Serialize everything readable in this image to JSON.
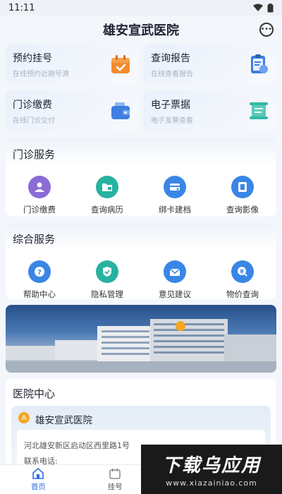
{
  "status": {
    "time": "11:11"
  },
  "header": {
    "title": "雄安宣武医院"
  },
  "quick": [
    {
      "title": "预约挂号",
      "subtitle": "在线预约近期号源",
      "icon": "calendar-icon",
      "color": "#f28b2c"
    },
    {
      "title": "查询报告",
      "subtitle": "在线查看报告",
      "icon": "report-icon",
      "color": "#3f7fe0"
    },
    {
      "title": "门诊缴费",
      "subtitle": "在线门诊交付",
      "icon": "wallet-icon",
      "color": "#3f7fe0"
    },
    {
      "title": "电子票据",
      "subtitle": "电子发票查看",
      "icon": "scroll-icon",
      "color": "#33b8a8"
    }
  ],
  "outpatient": {
    "title": "门诊服务",
    "items": [
      {
        "label": "门诊缴费",
        "icon": "user-pay-icon",
        "color": "#8b6bd6"
      },
      {
        "label": "查询病历",
        "icon": "folder-icon",
        "color": "#26b3a0"
      },
      {
        "label": "绑卡建档",
        "icon": "card-icon",
        "color": "#3a86e6"
      },
      {
        "label": "查询影像",
        "icon": "film-icon",
        "color": "#3a86e6"
      }
    ]
  },
  "general": {
    "title": "综合服务",
    "items": [
      {
        "label": "帮助中心",
        "icon": "help-icon",
        "color": "#3a86e6"
      },
      {
        "label": "隐私管理",
        "icon": "shield-icon",
        "color": "#26b3a0"
      },
      {
        "label": "意见建议",
        "icon": "mail-icon",
        "color": "#3a86e6"
      },
      {
        "label": "物价查询",
        "icon": "price-icon",
        "color": "#3a86e6"
      }
    ]
  },
  "hospital_center": {
    "title": "医院中心",
    "name": "雄安宣武医院",
    "address": "河北雄安新区启动区西里路1号",
    "phone_label": "联系电话:"
  },
  "tabs": [
    {
      "label": "首页",
      "icon": "home-icon",
      "active": true
    },
    {
      "label": "挂号",
      "icon": "calendar-tab-icon",
      "active": false
    }
  ],
  "watermark": {
    "main": "下载乌应用",
    "url": "www.xiazainiao.com"
  }
}
